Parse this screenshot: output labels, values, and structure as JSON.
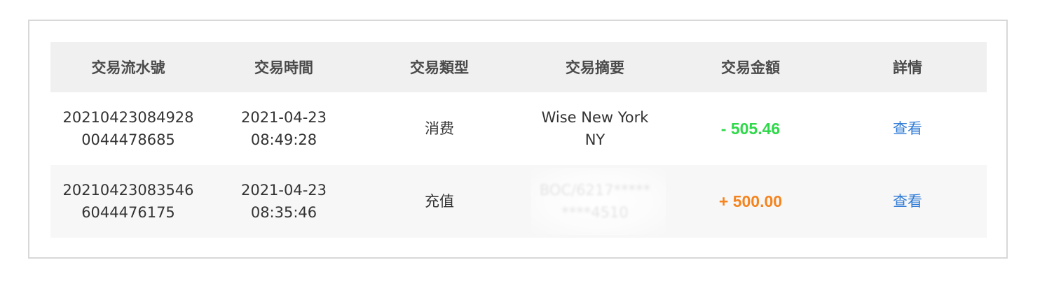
{
  "table": {
    "headers": [
      "交易流水號",
      "交易時間",
      "交易類型",
      "交易摘要",
      "交易金額",
      "詳情"
    ],
    "rows": [
      {
        "serial_line1": "20210423084928",
        "serial_line2": "0044478685",
        "date": "2021-04-23",
        "time": "08:49:28",
        "type": "消费",
        "summary_line1": "Wise New York",
        "summary_line2": "NY",
        "amount": "- 505.46",
        "amount_color": "#2fd84a",
        "detail": "查看"
      },
      {
        "serial_line1": "20210423083546",
        "serial_line2": "6044476175",
        "date": "2021-04-23",
        "time": "08:35:46",
        "type": "充值",
        "summary_line1": "BOC/6217*****",
        "summary_line2": "****4510",
        "summary_redacted": true,
        "amount": "+ 500.00",
        "amount_color": "#f5841f",
        "detail": "查看"
      }
    ]
  },
  "colors": {
    "header_bg": "#f0f0f0",
    "alt_row_bg": "#f7f7f7",
    "link": "#2f7bd6",
    "border": "#d8d8d8"
  }
}
